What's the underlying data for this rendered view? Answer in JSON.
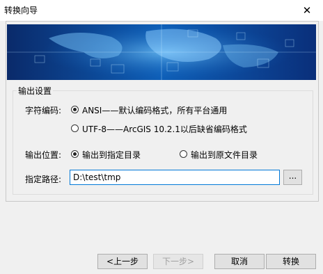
{
  "window": {
    "title": "转换向导",
    "close_glyph": "✕"
  },
  "group": {
    "legend": "输出设置"
  },
  "encoding": {
    "label": "字符编码:",
    "options": [
      {
        "label": "ANSI——默认编码格式，所有平台通用",
        "checked": true
      },
      {
        "label": "UTF-8——ArcGIS 10.2.1以后缺省编码格式",
        "checked": false
      }
    ]
  },
  "output_location": {
    "label": "输出位置:",
    "options": [
      {
        "label": "输出到指定目录",
        "checked": true
      },
      {
        "label": "输出到原文件目录",
        "checked": false
      }
    ]
  },
  "path": {
    "label": "指定路径:",
    "value": "D:\\test\\tmp",
    "browse_label": "..."
  },
  "buttons": {
    "prev": "<上一步",
    "next": "下一步>",
    "cancel": "取消",
    "convert": "转换"
  },
  "icons": {
    "close": "close-icon"
  }
}
